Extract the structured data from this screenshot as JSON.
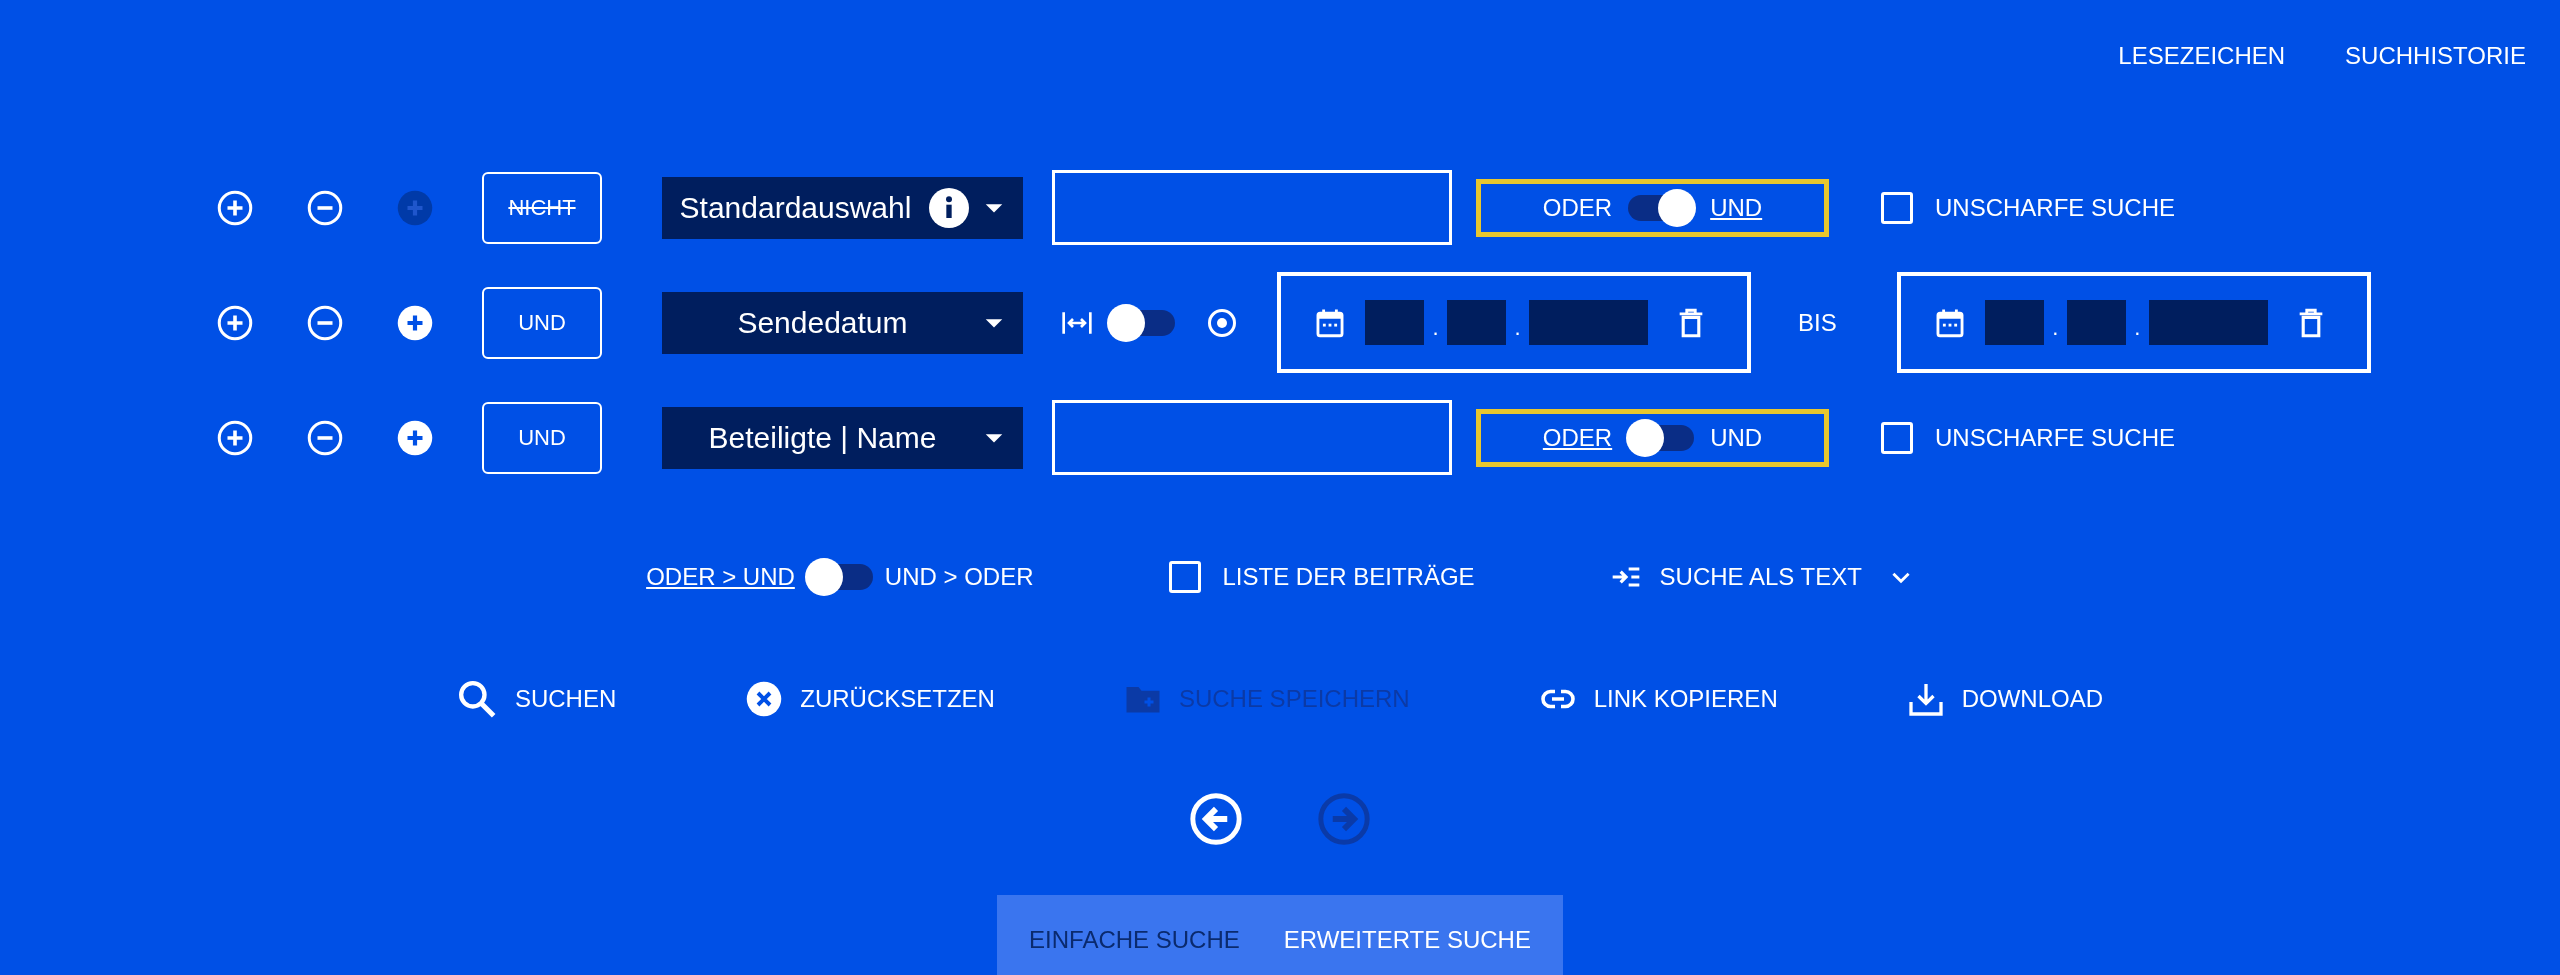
{
  "header_links": [
    {
      "label": "LESEZEICHEN"
    },
    {
      "label": "SUCHHISTORIE"
    }
  ],
  "rows": [
    {
      "kind": "text",
      "group_disabled": true,
      "operator": {
        "label": "NICHT",
        "struck": true
      },
      "field": {
        "label": "Standardauswahl",
        "info": true
      },
      "combine": {
        "left": "ODER",
        "right": "UND",
        "on": true
      },
      "fuzzy": {
        "label": "UNSCHARFE SUCHE",
        "checked": false
      }
    },
    {
      "kind": "date",
      "group_disabled": false,
      "operator": {
        "label": "UND",
        "struck": false
      },
      "field": {
        "label": "Sendedatum",
        "info": false
      },
      "range_toggle": {
        "on": false
      },
      "date_separator": ".",
      "between": "BIS"
    },
    {
      "kind": "text",
      "group_disabled": false,
      "operator": {
        "label": "UND",
        "struck": false
      },
      "field": {
        "label": "Beteiligte | Name",
        "info": false
      },
      "combine": {
        "left": "ODER",
        "right": "UND",
        "on": false
      },
      "fuzzy": {
        "label": "UNSCHARFE SUCHE",
        "checked": false
      }
    }
  ],
  "options": {
    "order_toggle": {
      "left": "ODER > UND",
      "right": "UND > ODER",
      "on": false
    },
    "list": {
      "label": "LISTE DER BEITRÄGE",
      "checked": false
    },
    "text_search": {
      "label": "SUCHE ALS TEXT",
      "expanded": false
    }
  },
  "actions": [
    {
      "kind": "search",
      "label": "SUCHEN",
      "disabled": false
    },
    {
      "kind": "reset",
      "label": "ZURÜCKSETZEN",
      "disabled": false
    },
    {
      "kind": "save",
      "label": "SUCHE SPEICHERN",
      "disabled": true
    },
    {
      "kind": "link",
      "label": "LINK KOPIEREN",
      "disabled": false
    },
    {
      "kind": "download",
      "label": "DOWNLOAD",
      "disabled": false
    }
  ],
  "pager": {
    "back_disabled": false,
    "forward_disabled": true
  },
  "tabs": [
    {
      "label": "EINFACHE SUCHE",
      "selected": false
    },
    {
      "label": "ERWEITERTE SUCHE",
      "selected": true
    }
  ]
}
